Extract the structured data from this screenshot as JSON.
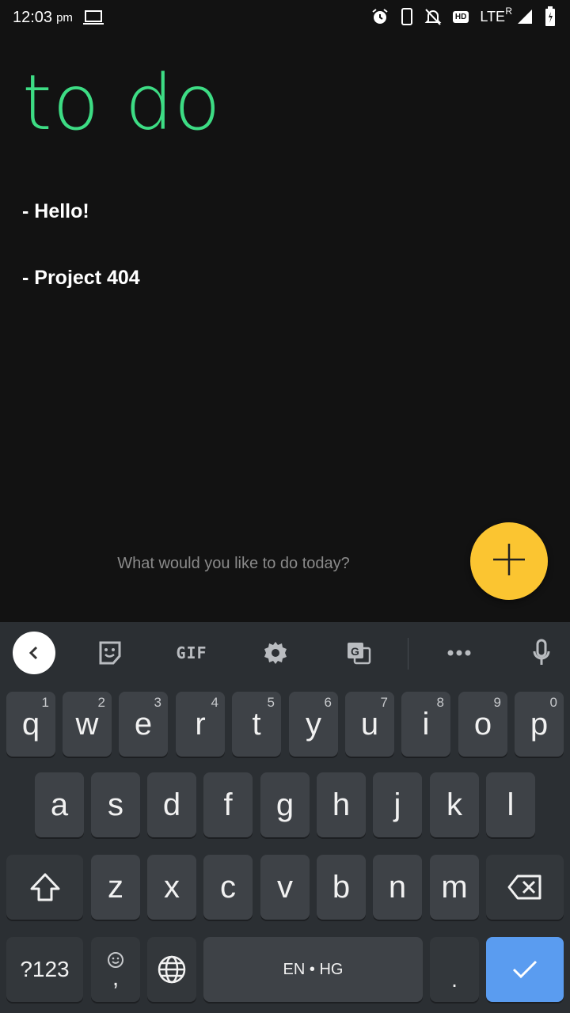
{
  "status_bar": {
    "time": "12:03",
    "ampm": "pm",
    "network": "LTE",
    "roaming": "R",
    "hd": "HD"
  },
  "app": {
    "title": "to do",
    "todos": [
      "- Hello!",
      "- Project 404"
    ],
    "input_placeholder": "What would you like to do today?",
    "accent_color": "#3ddc84",
    "fab_color": "#fbc531"
  },
  "keyboard": {
    "toolbar": {
      "gif_label": "GIF"
    },
    "row1": [
      {
        "label": "q",
        "hint": "1"
      },
      {
        "label": "w",
        "hint": "2"
      },
      {
        "label": "e",
        "hint": "3"
      },
      {
        "label": "r",
        "hint": "4"
      },
      {
        "label": "t",
        "hint": "5"
      },
      {
        "label": "y",
        "hint": "6"
      },
      {
        "label": "u",
        "hint": "7"
      },
      {
        "label": "i",
        "hint": "8"
      },
      {
        "label": "o",
        "hint": "9"
      },
      {
        "label": "p",
        "hint": "0"
      }
    ],
    "row2": [
      "a",
      "s",
      "d",
      "f",
      "g",
      "h",
      "j",
      "k",
      "l"
    ],
    "row3": [
      "z",
      "x",
      "c",
      "v",
      "b",
      "n",
      "m"
    ],
    "symbols_label": "?123",
    "comma_label": ",",
    "space_label": "EN • HG",
    "period_label": ".",
    "enter_color": "#5a9cf0"
  }
}
